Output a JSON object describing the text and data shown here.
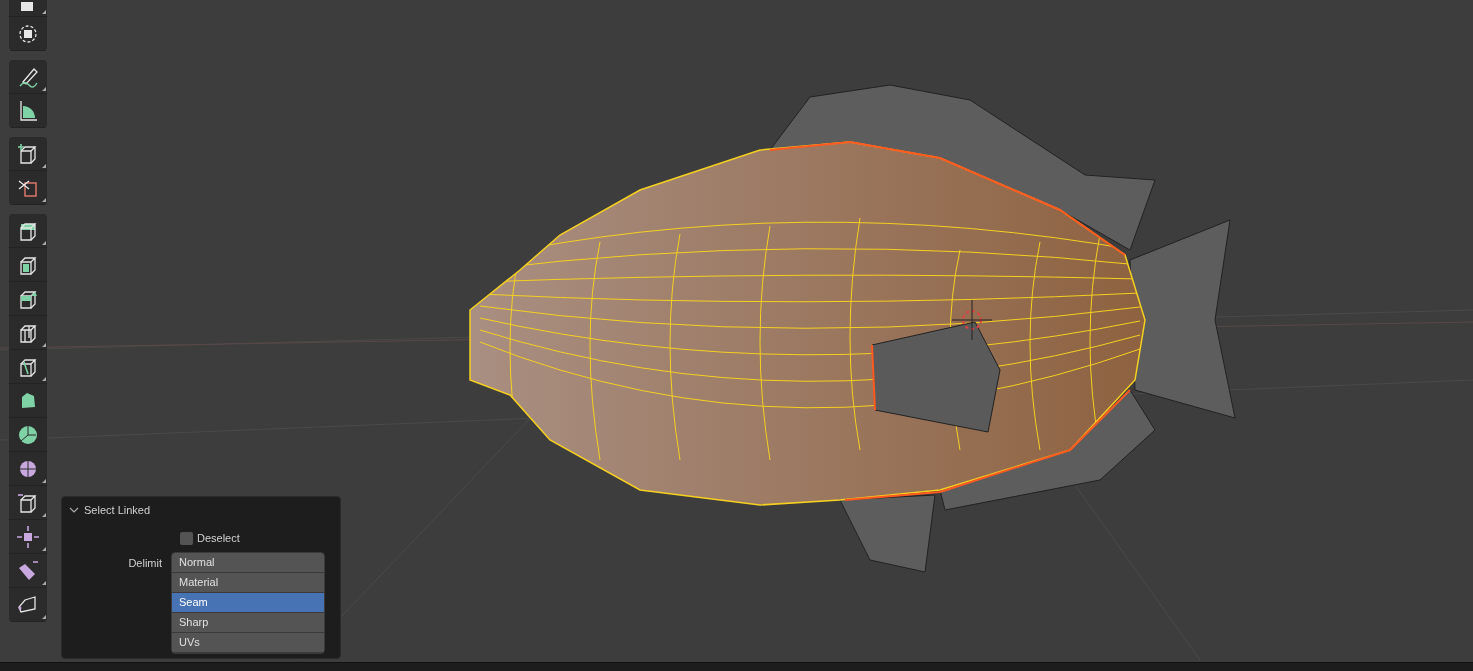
{
  "panel": {
    "title": "Select Linked",
    "expanded": true,
    "deselect": {
      "label": "Deselect",
      "checked": false
    },
    "delimit": {
      "label": "Delimit",
      "options": [
        {
          "label": "Normal",
          "selected": false
        },
        {
          "label": "Material",
          "selected": false
        },
        {
          "label": "Seam",
          "selected": true
        },
        {
          "label": "Sharp",
          "selected": false
        },
        {
          "label": "UVs",
          "selected": false
        }
      ]
    }
  }
}
